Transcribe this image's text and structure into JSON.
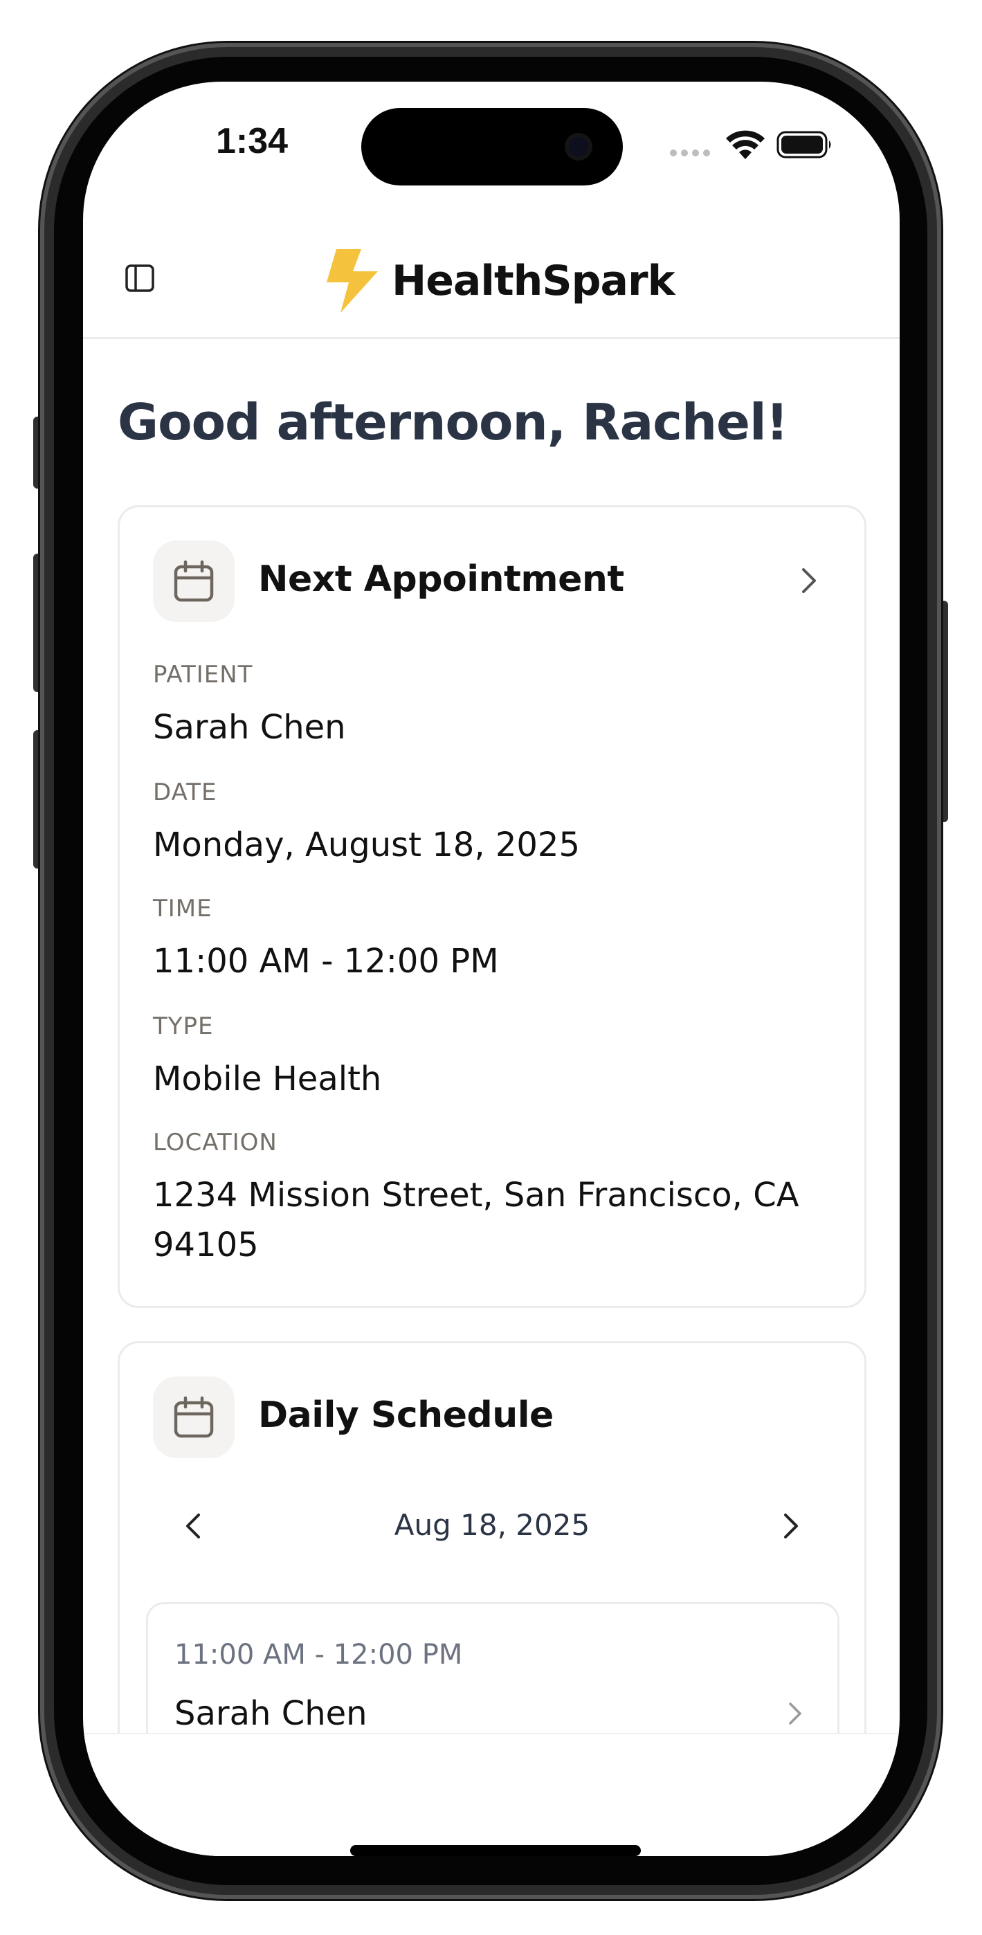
{
  "status_bar": {
    "time": "1:34"
  },
  "header": {
    "app_name": "HealthSpark",
    "logo_icon": "lightning-bolt-icon",
    "brand_color": "#f5c23e"
  },
  "greeting": "Good afternoon, Rachel!",
  "next_appointment": {
    "title": "Next Appointment",
    "fields": [
      {
        "label": "PATIENT",
        "value": "Sarah Chen"
      },
      {
        "label": "DATE",
        "value": "Monday, August 18, 2025"
      },
      {
        "label": "TIME",
        "value": "11:00 AM - 12:00 PM"
      },
      {
        "label": "TYPE",
        "value": "Mobile Health"
      },
      {
        "label": "LOCATION",
        "value": "1234 Mission Street, San Francisco, CA 94105"
      }
    ]
  },
  "daily_schedule": {
    "title": "Daily Schedule",
    "current_date": "Aug 18, 2025",
    "items": [
      {
        "time": "11:00 AM - 12:00 PM",
        "patient": "Sarah Chen"
      }
    ]
  },
  "colors": {
    "heading": "#2b3445",
    "label": "#746f68",
    "card_border": "#ebebeb"
  }
}
